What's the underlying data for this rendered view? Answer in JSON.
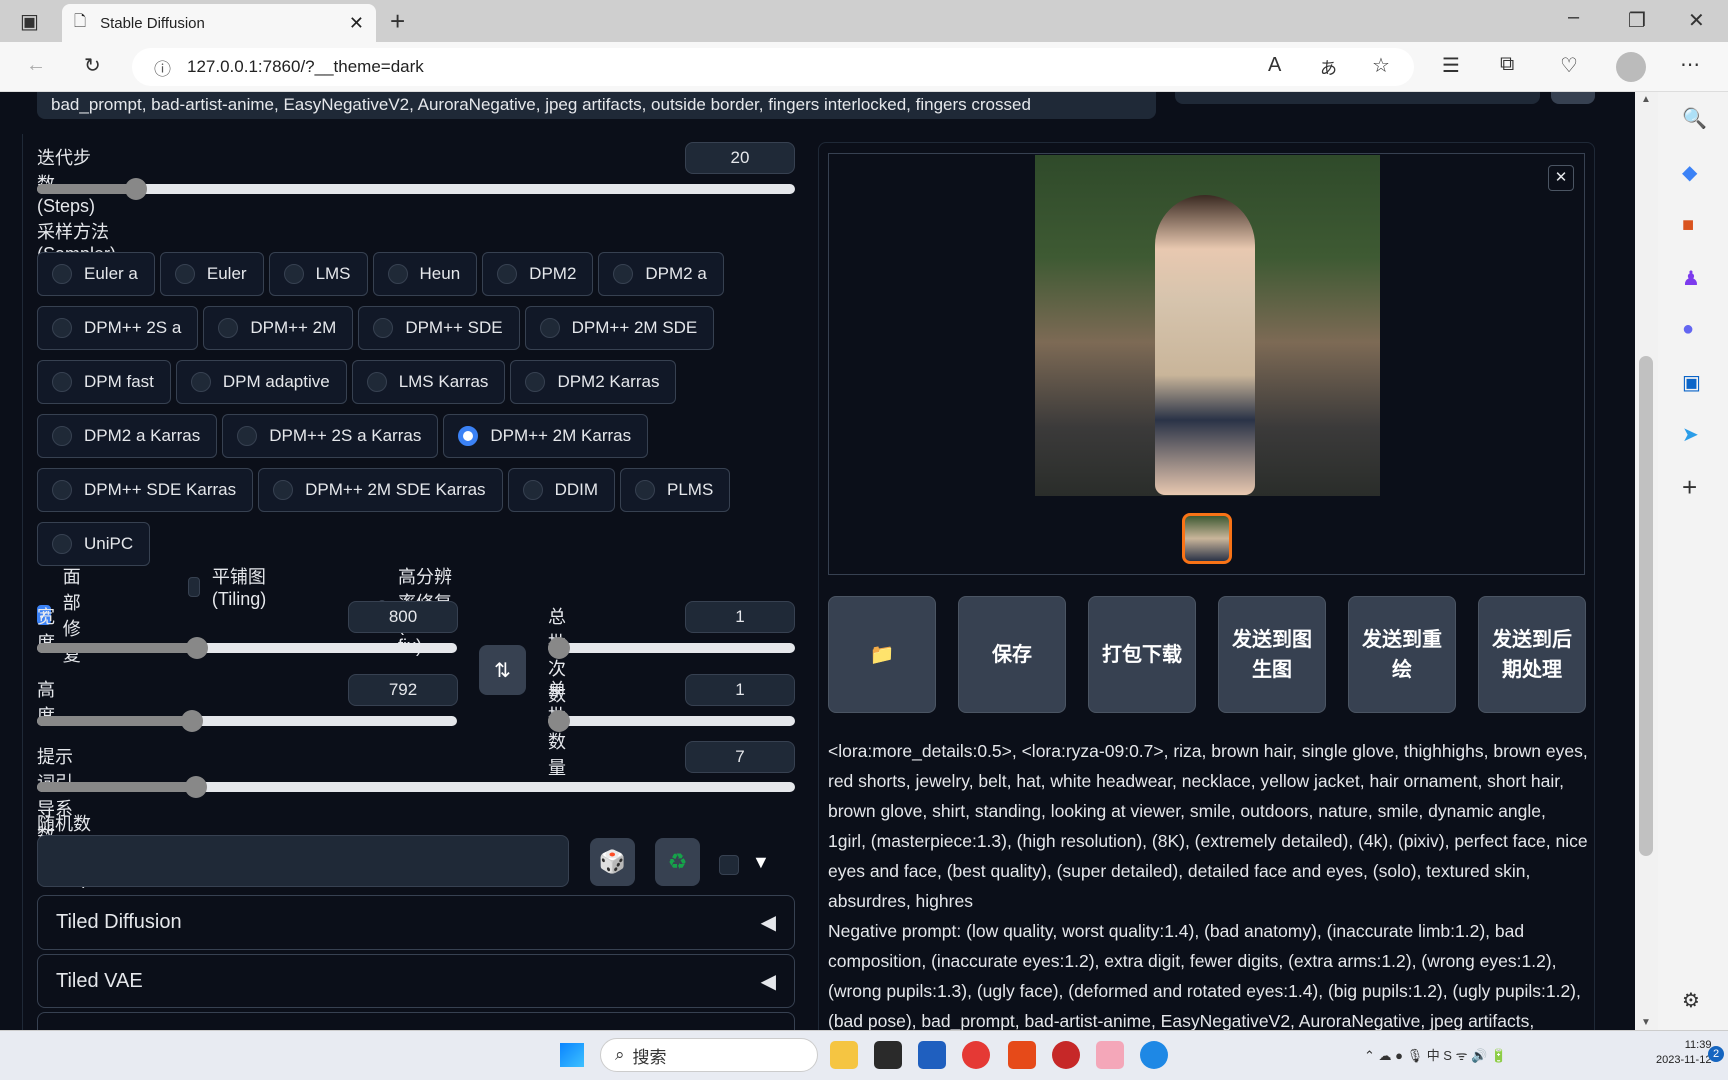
{
  "browser": {
    "tab_title": "Stable Diffusion",
    "url": "127.0.0.1:7860/?__theme=dark"
  },
  "prompt_remnant": "bad_prompt, bad-artist-anime, EasyNegativeV2, AuroraNegative, jpeg artifacts, outside border, fingers interlocked, fingers crossed",
  "steps": {
    "label": "迭代步数 (Steps)",
    "value": "20",
    "fraction": 0.13
  },
  "sampler": {
    "label": "采样方法 (Sampler)",
    "selected": "DPM++ 2M Karras",
    "options": [
      "Euler a",
      "Euler",
      "LMS",
      "Heun",
      "DPM2",
      "DPM2 a",
      "DPM++ 2S a",
      "DPM++ 2M",
      "DPM++ SDE",
      "DPM++ 2M SDE",
      "DPM fast",
      "DPM adaptive",
      "LMS Karras",
      "DPM2 Karras",
      "DPM2 a Karras",
      "DPM++ 2S a Karras",
      "DPM++ 2M Karras",
      "DPM++ SDE Karras",
      "DPM++ 2M SDE Karras",
      "DDIM",
      "PLMS",
      "UniPC"
    ]
  },
  "checkboxes": [
    {
      "label": "面部修复",
      "checked": true
    },
    {
      "label": "平铺图 (Tiling)",
      "checked": false
    },
    {
      "label": "高分辨率修复 (Hires. fix)",
      "checked": false
    }
  ],
  "width": {
    "label": "宽度",
    "value": "800",
    "fraction": 0.38
  },
  "height": {
    "label": "高度",
    "value": "792",
    "fraction": 0.37
  },
  "batch_count": {
    "label": "总批次数",
    "value": "1",
    "fraction": 0
  },
  "batch_size": {
    "label": "单批数量",
    "value": "1",
    "fraction": 0
  },
  "cfg": {
    "label": "提示词引导系数 (CFG Scale)",
    "value": "7",
    "fraction": 0.21
  },
  "seed": {
    "label": "随机数种子 (Seed)",
    "value": ""
  },
  "accordions": [
    "Tiled Diffusion",
    "Tiled VAE"
  ],
  "actions": [
    "📁",
    "保存",
    "打包下载",
    "发送到图生图",
    "发送到重绘",
    "发送到后期处理"
  ],
  "info": {
    "prompt": "<lora:more_details:0.5>, <lora:ryza-09:0.7>, riza, brown hair, single glove, thighhighs, brown eyes, red shorts, jewelry, belt, hat, white headwear, necklace, yellow jacket, hair ornament, short hair, brown glove, shirt, standing, looking at viewer, smile, outdoors, nature, smile, dynamic angle, 1girl, (masterpiece:1.3), (high resolution), (8K), (extremely detailed), (4k), (pixiv), perfect face, nice eyes and face, (best quality), (super detailed), detailed face and eyes, (solo), textured skin, absurdres, highres",
    "negative": "Negative prompt: (low quality, worst quality:1.4), (bad anatomy), (inaccurate limb:1.2), bad composition, (inaccurate eyes:1.2), extra digit, fewer digits, (extra arms:1.2), (wrong eyes:1.2), (wrong pupils:1.3), (ugly face), (deformed and rotated eyes:1.4), (big pupils:1.2), (ugly pupils:1.2), (bad pose), bad_prompt, bad-artist-anime, EasyNegativeV2, AuroraNegative, jpeg artifacts, outside"
  },
  "taskbar": {
    "search": "搜索",
    "time": "11:39",
    "date": "2023-11-12",
    "badge": "2"
  },
  "colors": {
    "bg": "#0b0f19",
    "accent": "#3b82f6",
    "button": "#374151",
    "thumb_border": "#f97316"
  }
}
